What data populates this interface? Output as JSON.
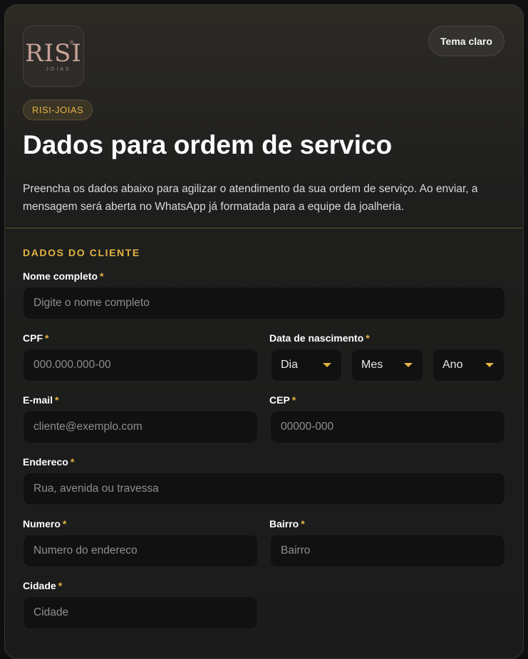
{
  "header": {
    "logo": {
      "mark": "RISI",
      "registered": "®",
      "subtitle": "JOIAS"
    },
    "theme_button": "Tema claro",
    "badge": "RISI-JOIAS",
    "title": "Dados para ordem de servico",
    "description": "Preencha os dados abaixo para agilizar o atendimento da sua ordem de serviço. Ao enviar, a mensagem será aberta no WhatsApp já formatada para a equipe da joalheria."
  },
  "section": {
    "title": "DADOS DO CLIENTE"
  },
  "required_mark": "*",
  "fields": {
    "nome": {
      "label": "Nome completo",
      "placeholder": "Digite o nome completo"
    },
    "cpf": {
      "label": "CPF",
      "placeholder": "000.000.000-00"
    },
    "nascimento": {
      "label": "Data de nascimento",
      "dia": "Dia",
      "mes": "Mes",
      "ano": "Ano"
    },
    "email": {
      "label": "E-mail",
      "placeholder": "cliente@exemplo.com"
    },
    "cep": {
      "label": "CEP",
      "placeholder": "00000-000"
    },
    "endereco": {
      "label": "Endereco",
      "placeholder": "Rua, avenida ou travessa"
    },
    "numero": {
      "label": "Numero",
      "placeholder": "Numero do endereco"
    },
    "bairro": {
      "label": "Bairro",
      "placeholder": "Bairro"
    },
    "cidade": {
      "label": "Cidade",
      "placeholder": "Cidade"
    }
  },
  "colors": {
    "accent": "#e4b442",
    "background": "#1b1b1b",
    "input": "#111111"
  }
}
